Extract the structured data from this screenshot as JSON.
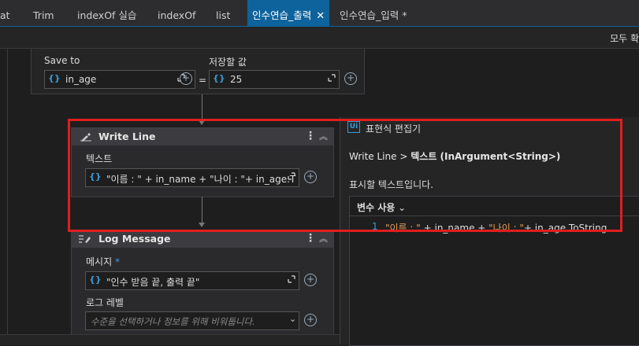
{
  "tabs": [
    {
      "label": "at",
      "active": false
    },
    {
      "label": "Trim",
      "active": false
    },
    {
      "label": "indexOf 실습",
      "active": false
    },
    {
      "label": "indexOf",
      "active": false
    },
    {
      "label": "list",
      "active": false
    },
    {
      "label": "인수연습_출력",
      "active": true,
      "close": "✕"
    },
    {
      "label": "인수연습_입력 *",
      "active": false
    }
  ],
  "toolbar": {
    "right_text": "모두 확"
  },
  "assign": {
    "save_to_label": "Save to",
    "save_to_value": "in_age",
    "equals": "=",
    "value_label": "저장할 값",
    "value_value": "25"
  },
  "write_line": {
    "title": "Write Line",
    "text_label": "텍스트",
    "text_value": "\"이름 : \" + in_name + \"나이 : \"+ in_age.T",
    "menu": "⋮",
    "collapse": "︽"
  },
  "log_message": {
    "title": "Log Message",
    "message_label": "메시지",
    "required_mark": "*",
    "message_value": "\"인수 받음 끝, 출력 끝\"",
    "level_label": "로그 레벨",
    "level_placeholder": "수준을 선택하거나 정보를 위해 비워둡니다.",
    "menu": "⋮",
    "collapse": "︽"
  },
  "expression_editor": {
    "logo": "Ui",
    "title": "표현식 편집기",
    "breadcrumb_activity": "Write Line",
    "breadcrumb_sep": ">",
    "breadcrumb_property": "텍스트 (InArgument<String>)",
    "description": "표시할 텍스트입니다.",
    "variables_menu": "변수 사용",
    "line_number": "1",
    "code_str1": "\"이름 : \"",
    "code_mid1": " + in_name + ",
    "code_str2": "\"나이 : \"",
    "code_mid2": "+ in_age.ToString"
  },
  "icons": {
    "brace": "{}",
    "plus": "+",
    "chevron": "⌄"
  },
  "colors": {
    "accent": "#0e639c",
    "highlight": "#e01e1e",
    "string": "#e4a05c",
    "variable_icon": "#3c9bd6"
  }
}
